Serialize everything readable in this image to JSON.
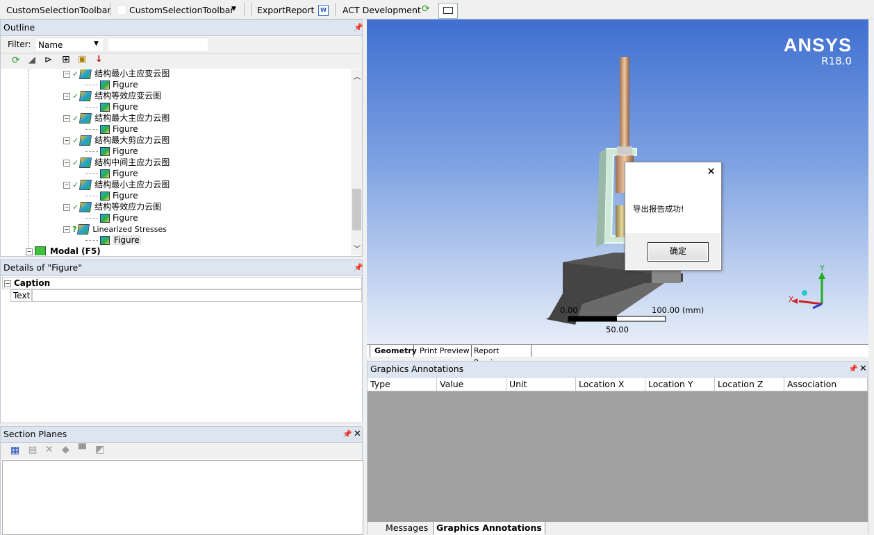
{
  "toolbar": {
    "item1": "CustomSelectionToolbar",
    "item2": "CustomSelectionToolbar",
    "item3": "ExportReport",
    "item4": "ACT Development"
  },
  "outline": {
    "title": "Outline",
    "filter_label": "Filter:",
    "filter_value": "Name",
    "tree": [
      {
        "label": "结构最小主应变云图",
        "child": "Figure"
      },
      {
        "label": "结构等效应变云图",
        "child": "Figure"
      },
      {
        "label": "结构最大主应力云图",
        "child": "Figure"
      },
      {
        "label": "结构最大剪应力云图",
        "child": "Figure"
      },
      {
        "label": "结构中间主应力云图",
        "child": "Figure"
      },
      {
        "label": "结构最小主应力云图",
        "child": "Figure"
      },
      {
        "label": "结构等效应力云图",
        "child": "Figure"
      },
      {
        "label": "Linearized Stresses",
        "child": "Figure"
      }
    ],
    "modal_label": "Modal (F5)"
  },
  "details": {
    "title": "Details of \"Figure\"",
    "group": "Caption",
    "row_label": "Text",
    "row_value": ""
  },
  "section_planes": {
    "title": "Section Planes"
  },
  "viewport": {
    "brand": "ANSYS",
    "version": "R18.0",
    "scale_start": "0.00",
    "scale_end": "100.00 (mm)",
    "scale_mid": "50.00",
    "axis_y": "Y",
    "axis_x": "X",
    "tabs": [
      "Geometry",
      "Print Preview",
      "Report Preview"
    ]
  },
  "dialog": {
    "message": "导出报告成功!",
    "ok_label": "确定"
  },
  "annotations": {
    "title": "Graphics Annotations",
    "columns": [
      "Type",
      "Value",
      "Unit",
      "Location X",
      "Location Y",
      "Location Z",
      "Association"
    ],
    "bottom_tabs": [
      "Messages",
      "Graphics Annotations"
    ]
  },
  "colors": {
    "accent": "#dde6f0",
    "viewport_top": "#3f6fd0",
    "check": "#1a9a1a"
  }
}
